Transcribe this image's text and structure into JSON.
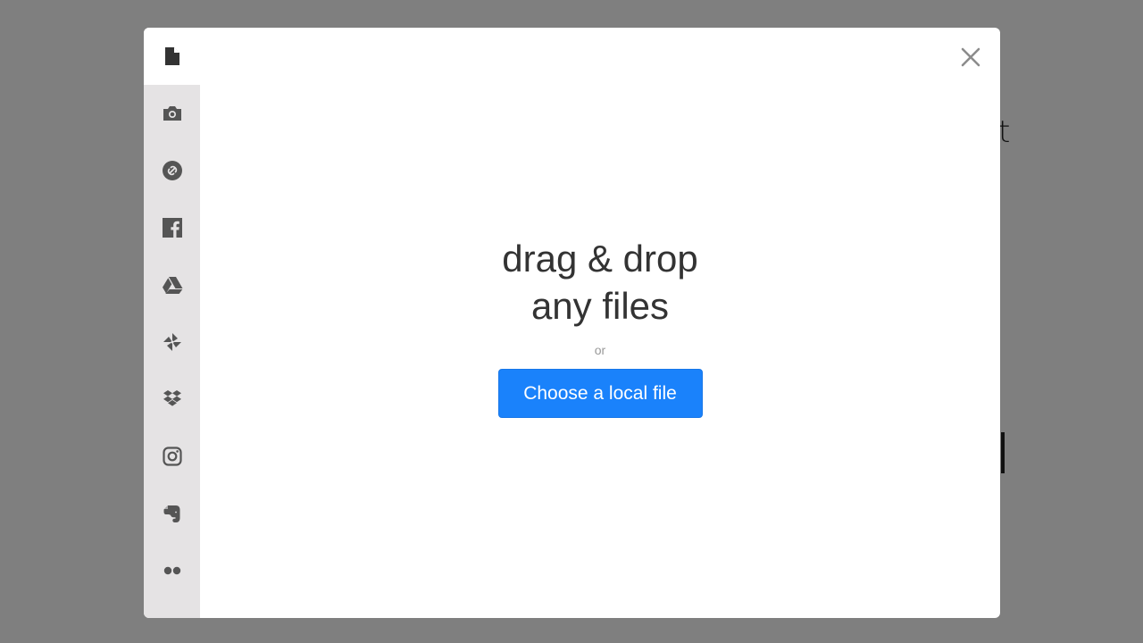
{
  "background_page": {
    "partial_text": "t"
  },
  "modal": {
    "close_label": "Close",
    "sidebar": {
      "items": [
        {
          "id": "local-files",
          "icon": "file-icon",
          "active": true
        },
        {
          "id": "webcam",
          "icon": "camera-icon",
          "active": false
        },
        {
          "id": "link",
          "icon": "link-icon",
          "active": false
        },
        {
          "id": "facebook",
          "icon": "facebook-icon",
          "active": false
        },
        {
          "id": "google-drive",
          "icon": "google-drive-icon",
          "active": false
        },
        {
          "id": "google-photos",
          "icon": "pinwheel-icon",
          "active": false
        },
        {
          "id": "dropbox",
          "icon": "dropbox-icon",
          "active": false
        },
        {
          "id": "instagram",
          "icon": "instagram-icon",
          "active": false
        },
        {
          "id": "evernote",
          "icon": "evernote-icon",
          "active": false
        },
        {
          "id": "flickr",
          "icon": "flickr-icon",
          "active": false
        }
      ]
    },
    "dropzone": {
      "headline_line1": "drag & drop",
      "headline_line2": "any files",
      "or_label": "or",
      "choose_button_label": "Choose a local file"
    }
  },
  "colors": {
    "overlay": "#7f7f7f",
    "sidebar_bg": "#e5e3e4",
    "icon": "#555555",
    "accent": "#1a82fb"
  }
}
